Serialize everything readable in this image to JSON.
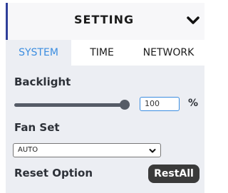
{
  "header": {
    "title": "SETTING",
    "toggle_icon": "chevron-down-icon"
  },
  "tabs": [
    {
      "label": "SYSTEM",
      "active": true
    },
    {
      "label": "TIME",
      "active": false
    },
    {
      "label": "NETWORK",
      "active": false
    }
  ],
  "backlight": {
    "label": "Backlight",
    "value": "100",
    "level_percent": 100,
    "unit": "%"
  },
  "fan_set": {
    "label": "Fan Set",
    "selected": "AUTO"
  },
  "reset": {
    "label": "Reset Option",
    "button_label": "RestAll"
  },
  "colors": {
    "accent": "#3b8de0",
    "header_bar": "#2f3f9a",
    "panel_bg": "#eceef3",
    "button_bg": "#3a3a3a"
  }
}
